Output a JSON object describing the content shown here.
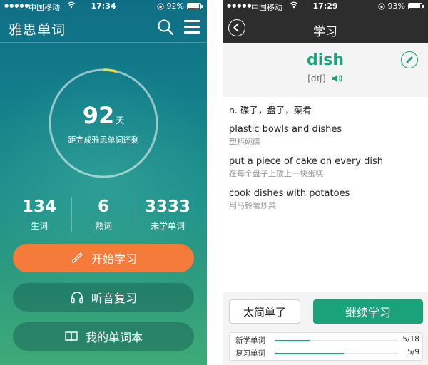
{
  "left": {
    "status": {
      "carrier": "中国移动",
      "time": "17:34",
      "battery": "92%",
      "battery_level": 0.92
    },
    "app_title": "雅思单词",
    "countdown": {
      "days": "92",
      "unit": "天",
      "caption": "距完成雅思单词还剩",
      "progress": 0.04,
      "ring_color": "#e8e23a"
    },
    "stats": [
      {
        "value": "134",
        "label": "生词"
      },
      {
        "value": "6",
        "label": "熟词"
      },
      {
        "value": "3333",
        "label": "未学单词"
      }
    ],
    "buttons": {
      "start": "开始学习",
      "listen": "听音复习",
      "wordbook": "我的单词本"
    },
    "colors": {
      "accent": "#f57b3a"
    }
  },
  "right": {
    "status": {
      "carrier": "中国移动",
      "time": "17:29",
      "battery": "93%",
      "battery_level": 0.93
    },
    "title": "学习",
    "word": "dish",
    "phonetic": "[dɪʃ]",
    "definition": "n. 碟子，盘子，菜肴",
    "examples": [
      {
        "en": "plastic bowls and dishes",
        "cn": "塑料碗碟"
      },
      {
        "en": "put a piece of cake on every dish",
        "cn": "在每个盘子上放上一块蛋糕"
      },
      {
        "en": "cook dishes with potatoes",
        "cn": "用马铃薯炒菜"
      }
    ],
    "buttons": {
      "easy": "太简单了",
      "continue": "继续学习"
    },
    "progress": [
      {
        "label": "新学单词",
        "count": "5/18",
        "fraction": 0.28
      },
      {
        "label": "复习单词",
        "count": "5/9",
        "fraction": 0.56
      }
    ],
    "colors": {
      "accent": "#1aa37a"
    }
  }
}
